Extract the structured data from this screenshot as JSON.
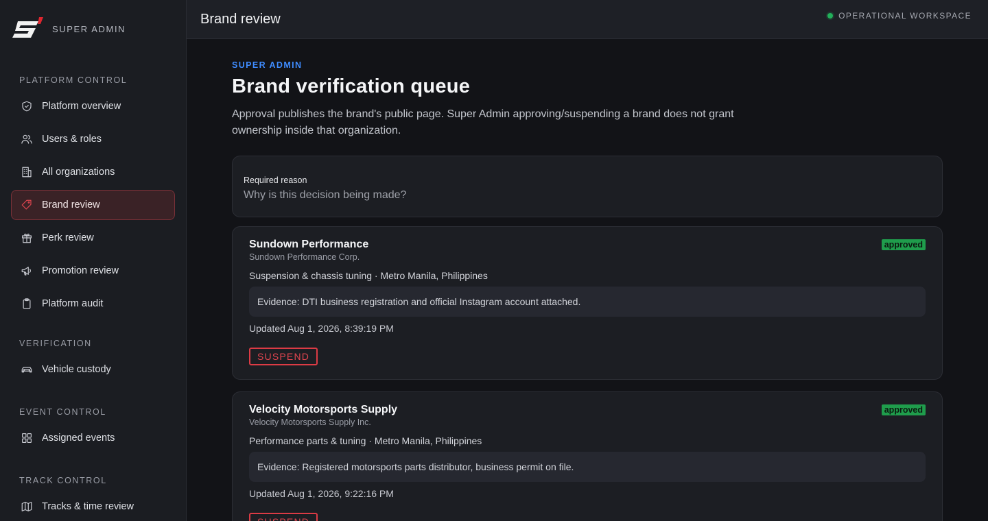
{
  "sidebar": {
    "brand_label": "SUPER ADMIN",
    "sections": [
      {
        "label": "PLATFORM CONTROL",
        "items": [
          {
            "label": "Platform overview",
            "icon": "shield-check-icon"
          },
          {
            "label": "Users & roles",
            "icon": "users-icon"
          },
          {
            "label": "All organizations",
            "icon": "building-icon"
          },
          {
            "label": "Brand review",
            "icon": "tag-icon",
            "active": true
          },
          {
            "label": "Perk review",
            "icon": "gift-icon"
          },
          {
            "label": "Promotion review",
            "icon": "megaphone-icon"
          },
          {
            "label": "Platform audit",
            "icon": "clipboard-icon"
          }
        ]
      },
      {
        "label": "VERIFICATION",
        "items": [
          {
            "label": "Vehicle custody",
            "icon": "car-icon"
          }
        ]
      },
      {
        "label": "EVENT CONTROL",
        "items": [
          {
            "label": "Assigned events",
            "icon": "grid-icon"
          }
        ]
      },
      {
        "label": "TRACK CONTROL",
        "items": [
          {
            "label": "Tracks & time review",
            "icon": "map-icon"
          }
        ]
      }
    ]
  },
  "topbar": {
    "title": "Brand review",
    "status": "OPERATIONAL WORKSPACE",
    "status_color": "#22b05a"
  },
  "page": {
    "eyebrow": "SUPER ADMIN",
    "title": "Brand verification queue",
    "description": "Approval publishes the brand's public page. Super Admin approving/suspending a brand does not grant ownership inside that organization."
  },
  "reason": {
    "label": "Required reason",
    "placeholder": "Why is this decision being made?",
    "value": ""
  },
  "brands": [
    {
      "name": "Sundown Performance",
      "legal_name": "Sundown Performance Corp.",
      "meta": "Suspension & chassis tuning · Metro Manila, Philippines",
      "evidence": "Evidence: DTI business registration and official Instagram account attached.",
      "updated": "Updated Aug 1, 2026, 8:39:19 PM",
      "status": "approved",
      "action": "SUSPEND"
    },
    {
      "name": "Velocity Motorsports Supply",
      "legal_name": "Velocity Motorsports Supply Inc.",
      "meta": "Performance parts & tuning · Metro Manila, Philippines",
      "evidence": "Evidence: Registered motorsports parts distributor, business permit on file.",
      "updated": "Updated Aug 1, 2026, 9:22:16 PM",
      "status": "approved",
      "action": "SUSPEND"
    }
  ],
  "colors": {
    "accent_red": "#e0454f",
    "accent_blue": "#3f8cff",
    "approved_green": "#1f9d4c"
  }
}
